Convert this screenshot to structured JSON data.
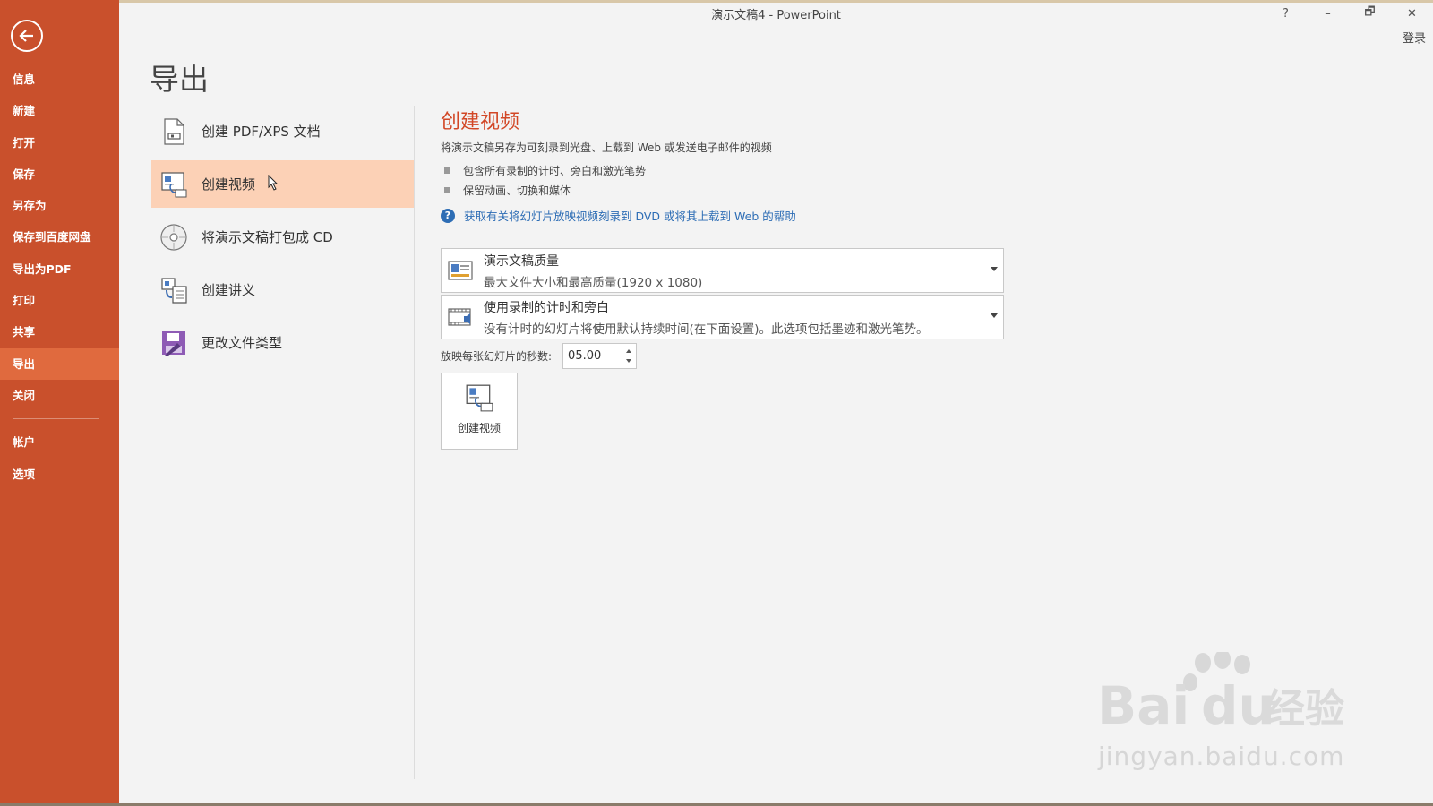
{
  "window": {
    "title": "演示文稿4 - PowerPoint",
    "help": "?",
    "minimize": "–",
    "restore": "🗗",
    "close": "✕",
    "signin": "登录"
  },
  "sidebar": {
    "items": [
      {
        "label": "信息"
      },
      {
        "label": "新建"
      },
      {
        "label": "打开"
      },
      {
        "label": "保存"
      },
      {
        "label": "另存为"
      },
      {
        "label": "保存到百度网盘"
      },
      {
        "label": "导出为PDF"
      },
      {
        "label": "打印"
      },
      {
        "label": "共享"
      },
      {
        "label": "导出"
      },
      {
        "label": "关闭"
      },
      {
        "label": "帐户"
      },
      {
        "label": "选项"
      }
    ],
    "active": "导出"
  },
  "page": {
    "title": "导出"
  },
  "export_options": [
    {
      "label": "创建 PDF/XPS 文档",
      "icon": "pdf-document-icon"
    },
    {
      "label": "创建视频",
      "icon": "video-icon"
    },
    {
      "label": "将演示文稿打包成 CD",
      "icon": "cd-icon"
    },
    {
      "label": "创建讲义",
      "icon": "handout-icon"
    },
    {
      "label": "更改文件类型",
      "icon": "file-type-icon"
    }
  ],
  "detail": {
    "title": "创建视频",
    "description": "将演示文稿另存为可刻录到光盘、上载到 Web 或发送电子邮件的视频",
    "bullets": [
      "包含所有录制的计时、旁白和激光笔势",
      "保留动画、切换和媒体"
    ],
    "help_link": "获取有关将幻灯片放映视频刻录到 DVD 或将其上载到 Web 的帮助"
  },
  "quality_dropdown": {
    "title": "演示文稿质量",
    "subtitle": "最大文件大小和最高质量(1920 x 1080)"
  },
  "timing_dropdown": {
    "title": "使用录制的计时和旁白",
    "subtitle": "没有计时的幻灯片将使用默认持续时间(在下面设置)。此选项包括墨迹和激光笔势。"
  },
  "seconds": {
    "label": "放映每张幻灯片的秒数:",
    "value": "05.00"
  },
  "create_button": {
    "label": "创建视频"
  },
  "watermark": {
    "text": "Bai",
    "text2": "du",
    "brand_cn": "经验",
    "url": "jingyan.baidu.com"
  },
  "colors": {
    "sidebar": "#c9502c",
    "sidebar_active": "#e06a3e",
    "selected_item": "#fcd1b6",
    "accent_title": "#d24726",
    "link": "#2d6db5"
  }
}
